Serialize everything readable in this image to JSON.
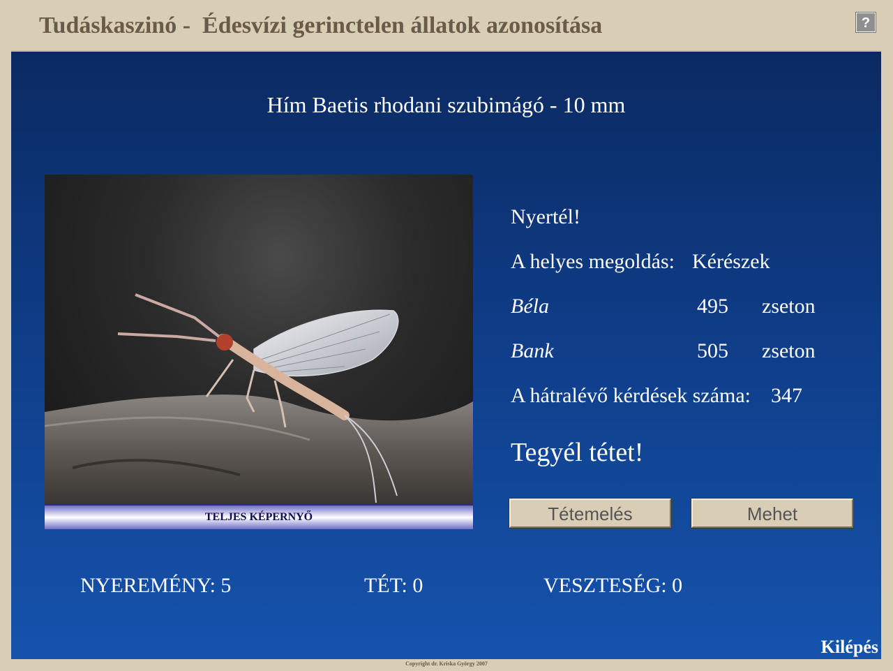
{
  "window": {
    "title": "Tudáskaszinó -  Édesvízi gerinctelen állatok azonosítása",
    "help_label": "?"
  },
  "question": {
    "subject": "Hím Baetis rhodani szubimágó - 10 mm",
    "image_icon": "mayfly-photo",
    "fullscreen_label": "TELJES KÉPERNYŐ"
  },
  "result": {
    "message": "Nyertél!",
    "answer_label": "A helyes megoldás:",
    "answer_value": "Kérészek",
    "players": [
      {
        "name": "Béla",
        "chips": "495",
        "unit": "zseton"
      },
      {
        "name": "Bank",
        "chips": "505",
        "unit": "zseton"
      }
    ],
    "remaining_label": "A hátralévő kérdések száma:",
    "remaining_value": "347",
    "prompt": "Tegyél tétet!"
  },
  "buttons": {
    "raise_bet": "Tétemelés",
    "go": "Mehet",
    "exit": "Kilépés"
  },
  "stats": {
    "winnings": "NYEREMÉNY: 5",
    "bet": "TÉT: 0",
    "loss": "VESZTESÉG: 0"
  },
  "footer": {
    "copyright": "Copyright dr. Kriska György 2007"
  },
  "colors": {
    "panel_top": "#0b2a62",
    "panel_bottom": "#1553ad",
    "frame": "#d9cdb5",
    "title_text": "#6a5a48"
  }
}
